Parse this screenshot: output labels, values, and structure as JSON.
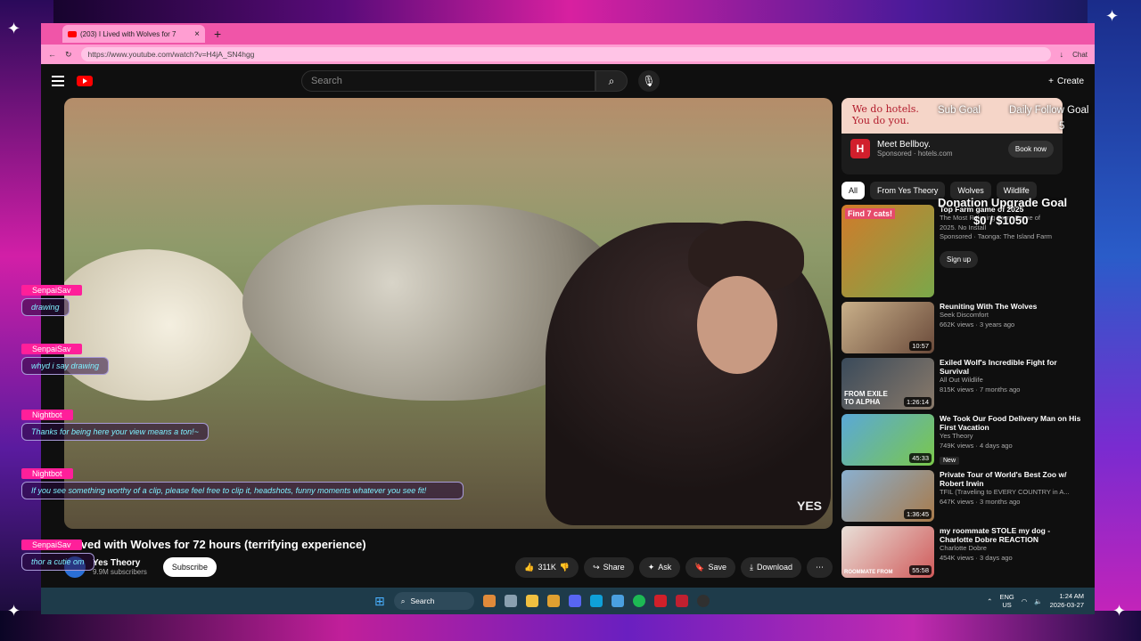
{
  "browser": {
    "tab_title": "(203) I Lived with Wolves for 7",
    "url": "https://www.youtube.com/watch?v=H4jA_SN4hgg",
    "chat_label": "Chat"
  },
  "youtube": {
    "search_placeholder": "Search",
    "create_label": "Create",
    "video": {
      "title": "I Lived with Wolves for 72 hours (terrifying experience)",
      "channel": "Yes Theory",
      "subscribers": "9.9M subscribers",
      "subscribe_label": "Subscribe",
      "watermark": "YES",
      "actions": {
        "likes": "311K",
        "share": "Share",
        "ask": "Ask",
        "save": "Save",
        "download": "Download"
      }
    },
    "ad": {
      "banner_line1": "We do hotels.",
      "banner_line2": "You do you.",
      "title": "Meet Bellboy.",
      "sponsor": "Sponsored",
      "domain": "hotels.com",
      "cta": "Book now",
      "logo_letter": "H"
    },
    "chips": [
      "All",
      "From Yes Theory",
      "Wolves",
      "Wildlife"
    ],
    "recommendations": [
      {
        "title": "Top Farm game of 2025",
        "line1": "The Most Relaxing Farm Game of",
        "line2": "2025. No Install",
        "line3": "Sponsored · Taonga: The Island Farm",
        "duration": "",
        "thumb_text": "Find 7 cats!",
        "cta": "Sign up"
      },
      {
        "title": "Reuniting With The Wolves",
        "line1": "Seek Discomfort",
        "line2": "662K views · 3 years ago",
        "duration": "10:57"
      },
      {
        "title": "Exiled Wolf's Incredible Fight for Survival",
        "line1": "All Out Wildlife",
        "line2": "815K views · 7 months ago",
        "duration": "1:26:14",
        "thumb_text": "FROM EXILE TO ALPHA"
      },
      {
        "title": "We Took Our Food Delivery Man on His First Vacation",
        "line1": "Yes Theory",
        "line2": "749K views · 4 days ago",
        "badge": "New",
        "duration": "45:33"
      },
      {
        "title": "Private Tour of World's Best Zoo w/ Robert Irwin",
        "line1": "TFIL (Traveling to EVERY COUNTRY in A...",
        "line2": "647K views · 3 months ago",
        "duration": "1:36:45"
      },
      {
        "title": "my roommate STOLE my dog - Charlotte Dobre REACTION",
        "line1": "Charlotte Dobre",
        "line2": "454K views · 3 days ago",
        "duration": "55:58",
        "thumb_text": "ROOMMATE FROM"
      }
    ]
  },
  "overlay": {
    "chat": [
      {
        "name": "SenpaiSav",
        "msg": "drawing"
      },
      {
        "name": "SenpaiSav",
        "msg": "whyd i say drawing"
      },
      {
        "name": "Nightbot",
        "msg": "Thanks for being here your view means a ton!~"
      },
      {
        "name": "Nightbot",
        "msg": "If you see something worthy of a clip, please feel free to clip it, headshots, funny moments whatever you see fit!"
      },
      {
        "name": "SenpaiSav",
        "msg": "thor a cutie om"
      }
    ],
    "goals": {
      "sub_goal": "Sub Goal",
      "follow_goal": "Daily Follow Goal",
      "follow_value": "5",
      "donation_goal": "Donation Upgrade Goal",
      "donation_value": "$0 / $1050"
    }
  },
  "taskbar": {
    "search_label": "Search",
    "lang": "ENG",
    "region": "US",
    "time": "1:24 AM",
    "date": "2026-03-27"
  },
  "colors": {
    "accent_pink": "#ff1f9a",
    "yt_red": "#ff0000",
    "chat_text": "#7ef0ff"
  }
}
